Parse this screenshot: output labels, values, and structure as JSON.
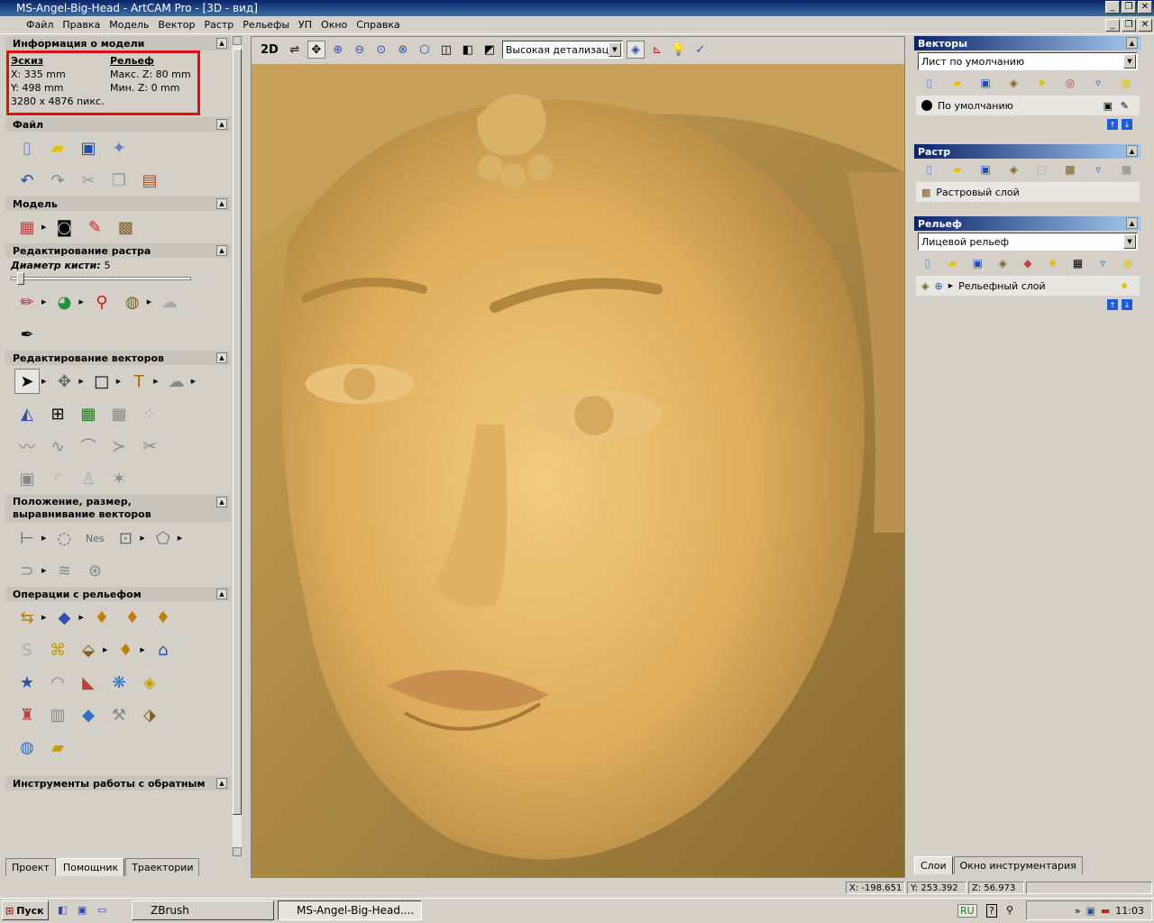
{
  "window": {
    "title": "MS-Angel-Big-Head - ArtCAM Pro - [3D - вид]"
  },
  "menu": [
    "Файл",
    "Правка",
    "Модель",
    "Вектор",
    "Растр",
    "Рельефы",
    "УП",
    "Окно",
    "Справка"
  ],
  "left": {
    "info_title": "Информация о модели",
    "sketch_label": "Эскиз",
    "relief_label": "Рельеф",
    "x": "X: 335 mm",
    "y": "Y: 498 mm",
    "pixels": "3280 x 4876 пикс.",
    "max_z": "Макс. Z: 80 mm",
    "min_z": "Мин. Z: 0 mm",
    "file_title": "Файл",
    "model_title": "Модель",
    "raster_edit_title": "Редактирование растра",
    "brush_label": "Диаметр кисти:",
    "brush_value": "5",
    "vector_edit_title": "Редактирование векторов",
    "position_title": "Положение, размер, выравнивание векторов",
    "relief_ops_title": "Операции с рельефом",
    "reverse_tools_title": "Инструменты работы с обратным",
    "tabs": [
      "Проект",
      "Помощник",
      "Траектории"
    ]
  },
  "view": {
    "mode_2d": "2D",
    "detail_select": "Высокая детализация"
  },
  "right": {
    "vectors_title": "Векторы",
    "vectors_sheet": "Лист по умолчанию",
    "vectors_layer": "По умолчанию",
    "raster_title": "Растр",
    "raster_layer": "Растровый слой",
    "relief_title": "Рельеф",
    "relief_select": "Лицевой рельеф",
    "relief_layer": "Рельефный слой",
    "tabs": [
      "Слои",
      "Окно инструментария"
    ]
  },
  "status": {
    "x": "X: -198.651",
    "y": "Y: 253.392",
    "z": "Z: 56.973"
  },
  "taskbar": {
    "start": "Пуск",
    "task1": "ZBrush",
    "task2": "MS-Angel-Big-Head....",
    "lang": "RU",
    "time": "11:03"
  }
}
